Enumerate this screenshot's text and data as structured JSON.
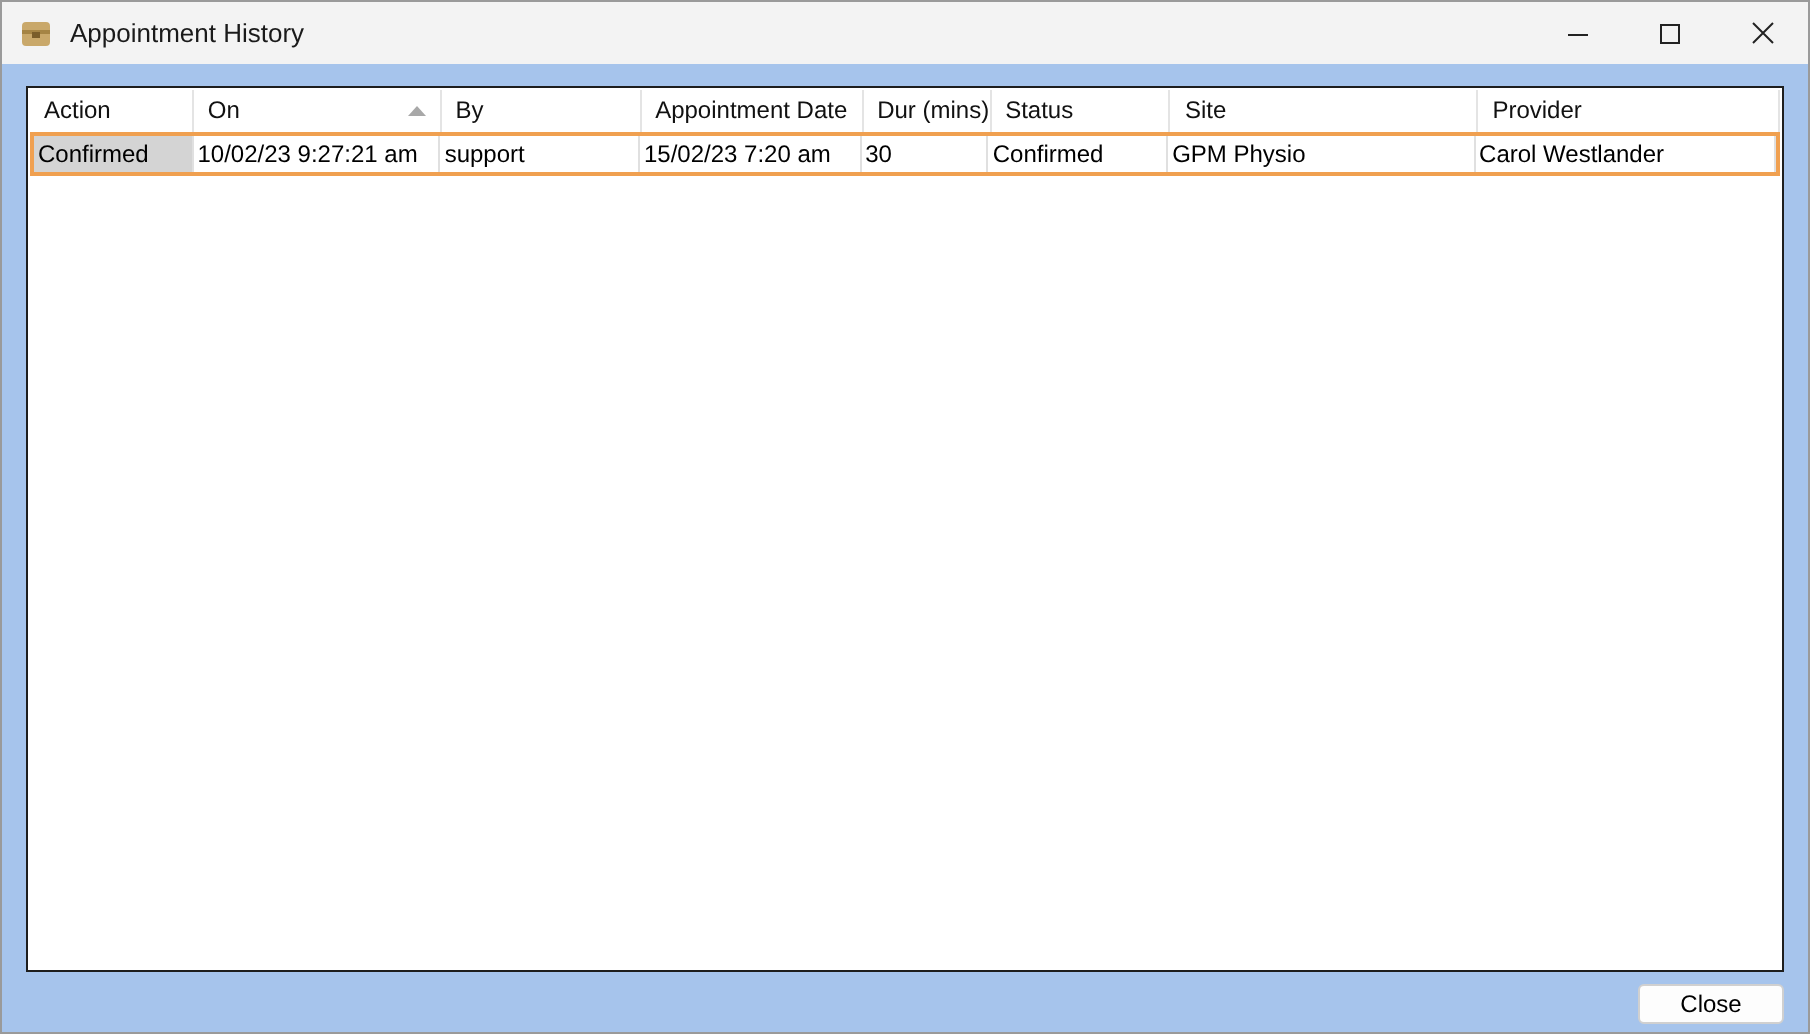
{
  "window": {
    "title": "Appointment History"
  },
  "table": {
    "columns": [
      {
        "label": "Action",
        "sorted": false
      },
      {
        "label": "On",
        "sorted": true
      },
      {
        "label": "By",
        "sorted": false
      },
      {
        "label": "Appointment Date",
        "sorted": false
      },
      {
        "label": "Dur (mins)",
        "sorted": false
      },
      {
        "label": "Status",
        "sorted": false
      },
      {
        "label": "Site",
        "sorted": false
      },
      {
        "label": "Provider",
        "sorted": false
      }
    ],
    "rows": [
      {
        "selected": true,
        "cells": [
          "Confirmed",
          "10/02/23 9:27:21 am",
          "support",
          "15/02/23 7:20 am",
          "30",
          "Confirmed",
          "GPM Physio",
          "Carol Westlander"
        ]
      }
    ]
  },
  "buttons": [
    "Close"
  ]
}
